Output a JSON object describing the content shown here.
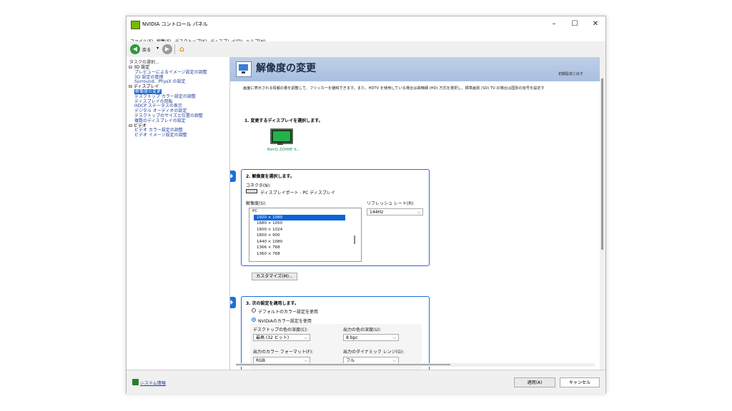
{
  "window": {
    "title": "NVIDIA コントロール パネル",
    "controls": {
      "minimize": "–",
      "maximize": "☐",
      "close": "✕"
    }
  },
  "menubar": {
    "items": [
      "ファイル(F)",
      "編集(E)",
      "デスクトップ(K)",
      "ディスプレイ(D)",
      "ヘルプ(H)"
    ]
  },
  "toolbar": {
    "back_label": "戻る",
    "dropdown": "▾"
  },
  "sidebar": {
    "heading": "タスクの選択...",
    "tree": [
      {
        "type": "cat",
        "label": "3D 設定"
      },
      {
        "type": "leaf",
        "label": "プレビューによるイメージ設定の調整"
      },
      {
        "type": "leaf",
        "label": "3D 設定の管理"
      },
      {
        "type": "leaf",
        "label": "Surround、PhysX の設定"
      },
      {
        "type": "cat",
        "label": "ディスプレイ"
      },
      {
        "type": "leaf",
        "label": "解像度の変更",
        "selected": true
      },
      {
        "type": "leaf",
        "label": "デスクトップ カラー設定の調整"
      },
      {
        "type": "leaf",
        "label": "ディスプレイの回転"
      },
      {
        "type": "leaf",
        "label": "HDCP ステータスの表示"
      },
      {
        "type": "leaf",
        "label": "デジタル オーディオの設定"
      },
      {
        "type": "leaf",
        "label": "デスクトップのサイズと位置の調整"
      },
      {
        "type": "leaf",
        "label": "複数のディスプレイの設定"
      },
      {
        "type": "cat",
        "label": "ビデオ"
      },
      {
        "type": "leaf",
        "label": "ビデオ カラー設定の調整"
      },
      {
        "type": "leaf",
        "label": "ビデオ イメージ設定の調整"
      }
    ]
  },
  "content": {
    "page_title": "解像度の変更",
    "restore_defaults": "初期設定に戻す",
    "description": "画面に表示される情報の量を調整して、フリッカーを緩和できます。また、HDTV を使用している場合は高精細 (HD) 方式を選択し、標準画質 (SD) TV の場合は国別の信号を設定す",
    "step1": {
      "title": "1. 変更するディスプレイを選択します。",
      "display_name": "BenQ ZOWIE X..."
    },
    "step2": {
      "title": "2. 解像度を選択します。",
      "connector_label": "コネクタ(N):",
      "connector_value": "ディスプレイポート - PC ディスプレイ",
      "resolution_label": "解像度(S):",
      "refresh_label": "リフレッシュ レート(R):",
      "refresh_value": "144Hz",
      "resolution_group": "PC",
      "resolutions": [
        "1920 × 1080",
        "1680 × 1050",
        "1600 × 1024",
        "1600 × 900",
        "1440 × 1080",
        "1366 × 768",
        "1360 × 768"
      ],
      "selected_index": 0,
      "customize_button": "カスタマイズ(M)..."
    },
    "step3": {
      "title": "3. 次の設定を適用します。",
      "radio_default": "デフォルトのカラー設定を使用",
      "radio_nvidia": "NVIDIAのカラー設定を使用",
      "desktop_depth_label": "デスクトップの色の深度(C):",
      "desktop_depth_value": "最高 (32 ビット)",
      "output_depth_label": "出力の色の深度(U):",
      "output_depth_value": "8 bpc",
      "output_format_label": "出力のカラー フォーマット(F):",
      "output_format_value": "RGB",
      "dynamic_range_label": "出力のダイナミック レンジ(G):",
      "dynamic_range_value": "フル"
    }
  },
  "statusbar": {
    "system_info": "システム情報",
    "apply_button": "適用(A)",
    "cancel_button": "キャンセル"
  },
  "colors": {
    "accent": "#1e6fd9",
    "banner": "#b4c8e6",
    "nvidia_green": "#76b900"
  }
}
